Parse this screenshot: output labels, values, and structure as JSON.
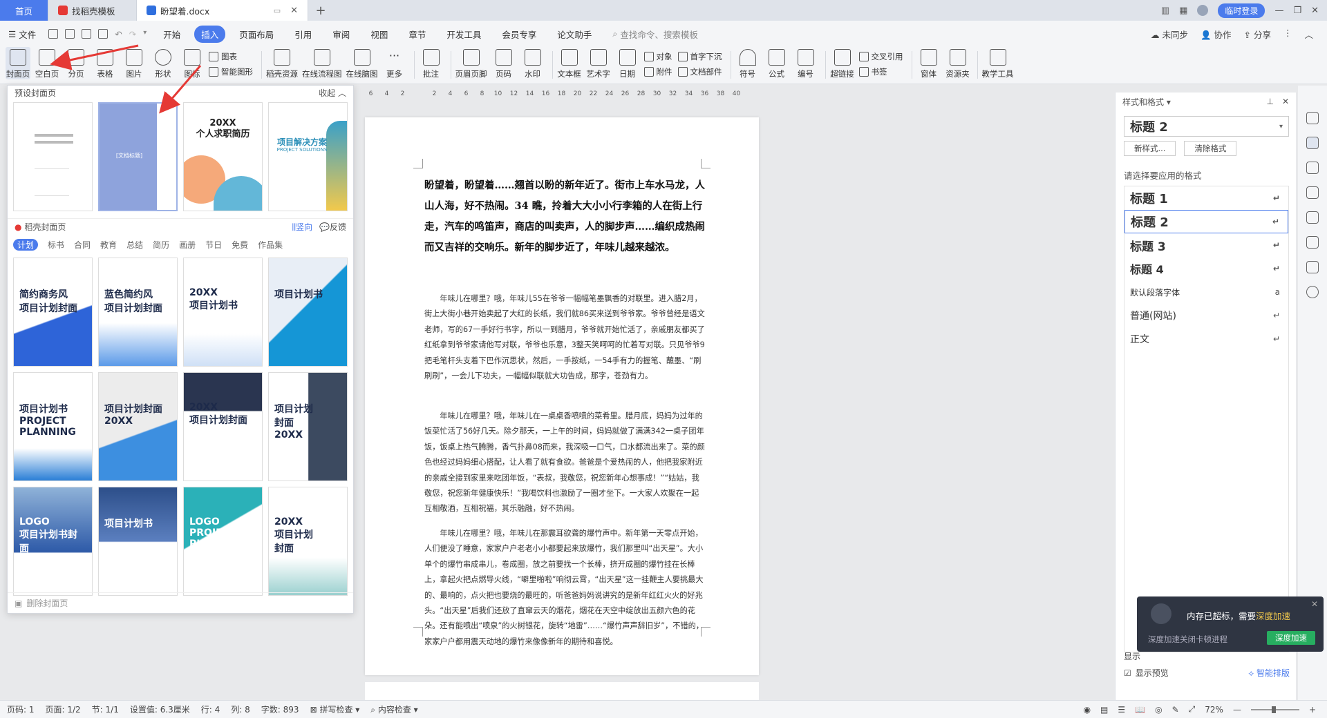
{
  "tabs": [
    {
      "label": "首页",
      "icon": "home"
    },
    {
      "label": "找稻壳模板",
      "icon": "docer-icon"
    },
    {
      "label": "盼望着.docx",
      "icon": "word-doc-icon"
    }
  ],
  "titlebar": {
    "login": "临时登录"
  },
  "menu": {
    "file": "文件",
    "items": [
      "开始",
      "插入",
      "页面布局",
      "引用",
      "审阅",
      "视图",
      "章节",
      "开发工具",
      "会员专享",
      "论文助手"
    ],
    "active": "插入",
    "search": "查找命令、搜索模板",
    "right": [
      "未同步",
      "协作",
      "分享"
    ]
  },
  "ribbon": {
    "big_a": [
      "封面页",
      "空白页",
      "分页",
      "表格",
      "图片",
      "形状",
      "图标"
    ],
    "chart": "图表",
    "smart_shape": "智能图形",
    "big_b": [
      "稻壳资源",
      "在线流程图",
      "在线脑图",
      "更多",
      "批注",
      "页眉页脚",
      "页码",
      "水印",
      "文本框",
      "艺术字",
      "日期"
    ],
    "object": "对象",
    "attachment": "附件",
    "dropcap": "首字下沉",
    "docpart": "文档部件",
    "big_c": [
      "符号",
      "公式",
      "编号",
      "超链接"
    ],
    "crossref": "交叉引用",
    "bookmark": "书签",
    "big_d": [
      "窗体",
      "资源夹",
      "教学工具"
    ]
  },
  "ruler": [
    "6",
    "4",
    "2",
    "",
    "2",
    "4",
    "6",
    "8",
    "10",
    "12",
    "14",
    "16",
    "18",
    "20",
    "22",
    "24",
    "26",
    "28",
    "30",
    "32",
    "34",
    "36",
    "38",
    "40"
  ],
  "cover_panel": {
    "preset_title": "预设封面页",
    "collapse": "收起",
    "presets": [
      {
        "title": "",
        "subtitle": ""
      },
      {
        "title": "",
        "subtitle": "[文档标题]"
      },
      {
        "title": "20XX\n个人求职简历",
        "subtitle": ""
      },
      {
        "title": "项目解决方案",
        "subtitle": "PROJECT SOLUTIONS"
      }
    ],
    "docer_title": "稻壳封面页",
    "vertical": "竖向",
    "feedback": "反馈",
    "categories": [
      "计划",
      "标书",
      "合同",
      "教育",
      "总结",
      "简历",
      "画册",
      "节日",
      "免费",
      "作品集"
    ],
    "active_category": "计划",
    "templates": [
      {
        "title": "简约商务风\n项目计划封面",
        "style": "blue-diag"
      },
      {
        "title": "蓝色简约风\n项目计划封面",
        "style": "blue-wave"
      },
      {
        "title": "20XX\n项目计划书",
        "style": "white-blue"
      },
      {
        "title": "项目计划书",
        "style": "photo-blue"
      },
      {
        "title": "项目计划书\nPROJECT PLANNING",
        "style": "white-stripe"
      },
      {
        "title": "项目计划封面\n20XX",
        "style": "gray-blue"
      },
      {
        "title": "20XX\n项目计划封面",
        "style": "dark-photo"
      },
      {
        "title": "项目计划\n封面\n20XX",
        "style": "building"
      },
      {
        "title": "LOGO\n项目计划书封面",
        "style": "city-blue"
      },
      {
        "title": "项目计划书",
        "style": "city-night"
      },
      {
        "title": "LOGO\nPROJECT PLAN\n项目计划书封面",
        "style": "teal-tri"
      },
      {
        "title": "20XX\n项目计划\n封面",
        "style": "white-teal"
      }
    ],
    "delete": "删除封面页"
  },
  "document": {
    "heading": "盼望着，盼望着……翘首以盼的新年近了。街市上车水马龙，人山人海，好不热闹。34 瞧，拎着大大小小行李箱的人在街上行走，汽车的鸣笛声，商店的叫卖声，人的脚步声……编织成热闹而又吉祥的交响乐。新年的脚步近了，年味儿越来越浓。",
    "p1": "年味儿在哪里？哦，年味儿55在爷爷一幅幅笔墨飘香的对联里。进入腊2月，街上大街小巷开始卖起了大红的长纸，我们就86买来送到爷爷家。爷爷曾经是语文老师，写的67一手好行书字，所以一到腊月，爷爷就开始忙活了，亲戚朋友都买了红纸拿到爷爷家请他写对联，爷爷也乐意，3整天笑呵呵的忙着写对联。只见爷爷9把毛笔杆头支着下巴作沉思状，然后，一手按纸，一54手有力的握笔、蘸墨、“刷刷刷”，一会儿下功夫，一幅幅似联就大功告成，那字，苍劲有力。",
    "p2": "年味儿在哪里？哦，年味儿在一桌桌香喷喷的菜肴里。腊月底，妈妈为过年的饭菜忙活了56好几天。除夕那天，一上午的时间，妈妈就做了满满342一桌子团年饭，饭桌上热气腾腾，香气扑鼻08而来，我深吸一口气，口水都流出来了。菜的颜色也经过妈妈细心搭配，让人看了就有食欲。爸爸是个爱热闹的人，他把我家附近的亲戚全接到家里来吃团年饭，“表叔，我敬您，祝您新年心想事成！”“姑姑，我敬您，祝您新年健康快乐！”我喝饮料也激励了一圈才坐下。一大家人欢聚在一起互相敬酒，互相祝福，其乐融融，好不热闹。",
    "p3": "年味儿在哪里？哦，年味儿在那震耳欲聋的爆竹声中。新年第一天零点开始，人们便没了睡意，家家户户老老小小都要起来放爆竹，我们那里叫“出天星”。大小单个的爆竹串成串儿，卷成圈，放之前要找一个长棒，挤开成圈的爆竹挂在长棒上，拿起火把点燃导火线，“噼里啪啦”响彻云霄，“出天星”这一挂鞭主人要挑最大的、最响的，点火把也要烧的最旺的，听爸爸妈妈说讲究的是新年红红火火的好兆头。“出天星”后我们还放了直窜云天的烟花，烟花在天空中绽放出五颜六色的花朵。还有能喷出“喷泉”的火树银花，旋转“地雷”……“爆竹声声辞旧岁”，不错的，家家户户都用震天动地的爆竹来像像新年的期待和喜悦。"
  },
  "styles_panel": {
    "title": "样式和格式",
    "current": "标题  2",
    "new_style": "新样式...",
    "clear": "清除格式",
    "apply_label": "请选择要应用的格式",
    "styles": [
      "标题  1",
      "标题  2",
      "标题  3",
      "标题  4",
      "默认段落字体",
      "普通(网站)",
      "正文"
    ],
    "selected_index": 1,
    "show_label": "显示",
    "preview": "显示预览",
    "smart": "智能排版"
  },
  "toast": {
    "msg_prefix": "内存已超标，需要",
    "msg_link": "深度加速",
    "sub": "深度加速关闭卡顿进程",
    "button": "深度加速"
  },
  "statusbar": {
    "page": "页码: 1",
    "pages": "页面: 1/2",
    "section": "节: 1/1",
    "setting": "设置值: 6.3厘米",
    "row": "行: 4",
    "col": "列: 8",
    "words": "字数: 893",
    "spell": "拼写检查",
    "content": "内容检查",
    "zoom": "72%"
  },
  "colors": {
    "accent": "#4b7bec",
    "arrow": "#e53935",
    "toast_bg": "#2f3542",
    "toast_btn": "#27ae60"
  }
}
